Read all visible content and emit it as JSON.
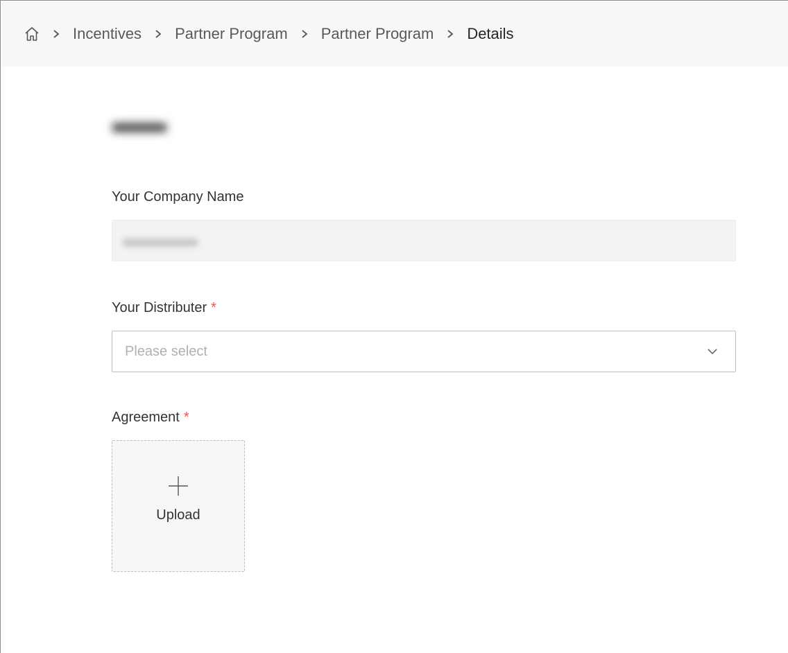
{
  "breadcrumb": {
    "home_icon": "home-icon",
    "separator_icon": "chevron-right-icon",
    "items": [
      "Incentives",
      "Partner Program",
      "Partner Program"
    ],
    "current": "Details"
  },
  "form": {
    "company_name_label": "Your Company Name",
    "distributer_label": "Your Distributer",
    "distributer_placeholder": "Please select",
    "agreement_label": "Agreement",
    "required_mark": "*",
    "upload_label": "Upload"
  },
  "colors": {
    "required": "#ff4d4f",
    "breadcrumb_bg": "#f7f7f7",
    "readonly_bg": "#f3f3f3"
  }
}
